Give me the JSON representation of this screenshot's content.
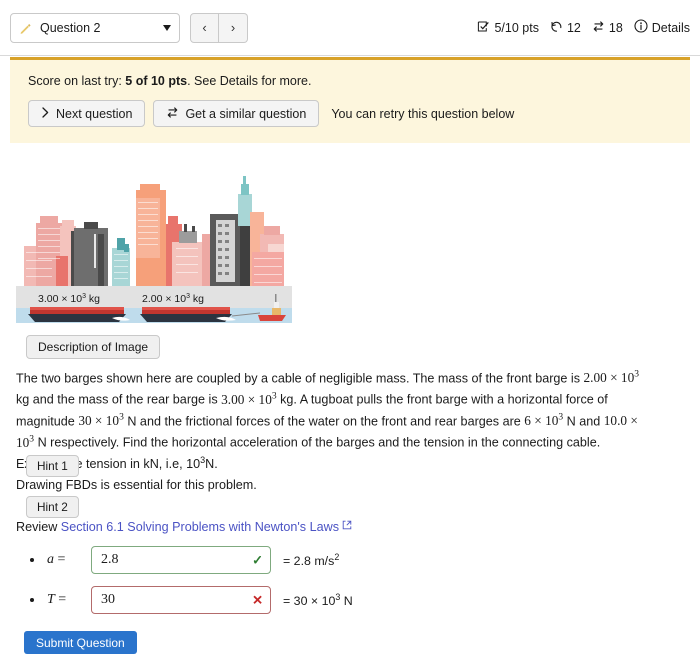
{
  "topbar": {
    "question_selector": {
      "label": "Question 2",
      "icon": "pencil-icon",
      "caret": "chevron-down-icon"
    },
    "prev_label": "‹",
    "next_label": "›",
    "status": {
      "score": "5/10 pts",
      "attempts": "12",
      "retries": "18",
      "details_label": "Details"
    }
  },
  "alert": {
    "score_prefix": "Score on last try: ",
    "score_value": "5 of 10 pts",
    "score_suffix": ". See Details for more.",
    "next_question_label": "Next question",
    "similar_question_label": "Get a similar question",
    "retry_note": "You can retry this question below"
  },
  "figure": {
    "rear_barge_mass": "3.00 × 10",
    "rear_barge_exp": "3",
    "rear_barge_unit": " kg",
    "front_barge_mass": "2.00 × 10",
    "front_barge_exp": "3",
    "front_barge_unit": " kg",
    "description_button": "Description of Image"
  },
  "problem": {
    "line1": "The two barges shown here are coupled by a cable of negligible mass. The mass of the front barge is",
    "seg_a": "2.00 × 10",
    "seg_a_exp": "3",
    "seg_b": " kg and the mass of the rear barge is ",
    "seg_c": "3.00 × 10",
    "seg_c_exp": "3",
    "seg_d": " kg. A tugboat pulls the front barge with a",
    "seg_e": "horizontal force of magnitude ",
    "seg_f": "30 × 10",
    "seg_f_exp": "3",
    "seg_g": " N and the frictional forces of the water on the front and rear barges",
    "seg_h": "are ",
    "seg_i": "6 × 10",
    "seg_i_exp": "3",
    "seg_j": " N and ",
    "seg_k": "10.0 × 10",
    "seg_k_exp": "3",
    "seg_l": " N respectively. Find the horizontal acceleration of the barges and the tension",
    "seg_m": "in the connecting cable. Express the tension in kN, i.e, 10",
    "seg_m_exp": "3",
    "seg_n": "N."
  },
  "hints": {
    "hint1_label": "Hint 1",
    "hint1_text": "Drawing FBDs is essential for this problem.",
    "hint2_label": "Hint 2",
    "hint2_prefix": "Review ",
    "hint2_link": "Section 6.1 Solving Problems with Newton's Laws"
  },
  "answers": {
    "rows": [
      {
        "var": "a",
        "eq": " =",
        "value": "2.8",
        "status": "correct",
        "mark": "✓",
        "unit_prefix": "= 2.8 m/s",
        "unit_exp": "2",
        "unit_suffix": ""
      },
      {
        "var": "T",
        "eq": " =",
        "value": "30",
        "status": "incorrect",
        "mark": "✕",
        "unit_prefix": "= 30  × 10",
        "unit_exp": "3",
        "unit_suffix": " N"
      }
    ]
  },
  "submit": {
    "label": "Submit Question"
  },
  "colors": {
    "alert_bg": "#fdf6dd",
    "alert_border": "#d8a22a",
    "link": "#4b53c4",
    "submit_bg": "#2a74cc",
    "correct": "#2e7d32",
    "incorrect": "#c62828"
  }
}
